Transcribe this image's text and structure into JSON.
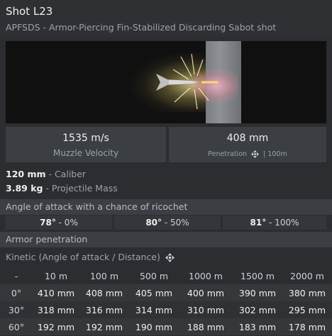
{
  "header": {
    "title": "Shot L23",
    "subtitle": "APFSDS - Armor-Piercing Fin-Stabilized Discarding Sabot shot"
  },
  "stats": {
    "velocity": {
      "value": "1535 m/s",
      "label": "Muzzle Velocity"
    },
    "penetration": {
      "value": "408 mm",
      "label": "Penetration",
      "suffix": "| 100m"
    }
  },
  "props": {
    "caliber": {
      "value": "120 mm",
      "label": " - Caliber"
    },
    "mass": {
      "value": "3.89 kg",
      "label": " - Projectile Mass"
    }
  },
  "ricochet": {
    "title": "Angle of attack with a chance of ricochet",
    "items": [
      {
        "angle": "78°",
        "chance": " - 0%"
      },
      {
        "angle": "80°",
        "chance": " - 50%"
      },
      {
        "angle": "81°",
        "chance": " - 100%"
      }
    ]
  },
  "armor": {
    "title": "Armor penetration",
    "kinetic_label": "Kinetic (Angle of attack / Distance)",
    "corner": "-",
    "columns": [
      "10 m",
      "100 m",
      "500 m",
      "1000 m",
      "1500 m",
      "2000 m"
    ],
    "rows": [
      {
        "angle": "0°",
        "values": [
          "410 mm",
          "408 mm",
          "405 mm",
          "400 mm",
          "390 mm",
          "380 mm"
        ]
      },
      {
        "angle": "30°",
        "values": [
          "318 mm",
          "316 mm",
          "314 mm",
          "310 mm",
          "302 mm",
          "295 mm"
        ]
      },
      {
        "angle": "60°",
        "values": [
          "192 mm",
          "192 mm",
          "190 mm",
          "188 mm",
          "183 mm",
          "178 mm"
        ]
      }
    ]
  },
  "colors": {
    "background": "#2b2d30",
    "panel": "#3b3e42",
    "text": "#f0f0f0",
    "muted": "#9aa3ab"
  },
  "icons": [
    "move-arrows-icon"
  ]
}
